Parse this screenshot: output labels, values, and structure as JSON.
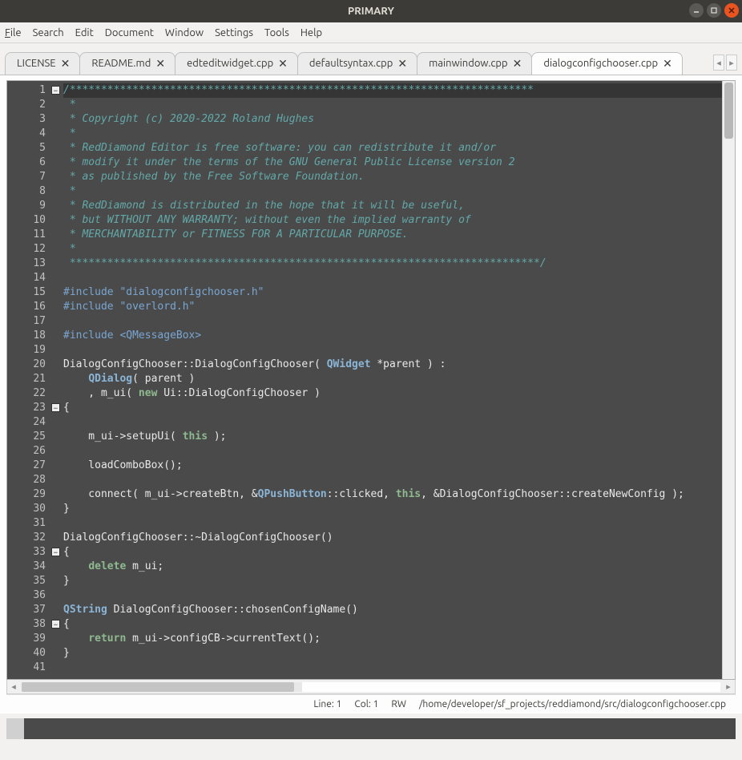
{
  "window": {
    "title": "PRIMARY"
  },
  "menu": {
    "file": "File",
    "search": "Search",
    "edit": "Edit",
    "document": "Document",
    "window": "Window",
    "settings": "Settings",
    "tools": "Tools",
    "help": "Help"
  },
  "tabs": [
    {
      "label": "LICENSE",
      "active": false
    },
    {
      "label": "README.md",
      "active": false
    },
    {
      "label": "edteditwidget.cpp",
      "active": false
    },
    {
      "label": "defaultsyntax.cpp",
      "active": false
    },
    {
      "label": "mainwindow.cpp",
      "active": false
    },
    {
      "label": "dialogconfigchooser.cpp",
      "active": true
    }
  ],
  "tabnav": {
    "left": "◂",
    "right": "▸"
  },
  "gutter_lines": 41,
  "fold_markers": [
    {
      "line": 1,
      "symbol": "−"
    },
    {
      "line": 23,
      "symbol": "−"
    },
    {
      "line": 33,
      "symbol": "−"
    },
    {
      "line": 38,
      "symbol": "−"
    }
  ],
  "code_lines": [
    {
      "n": 1,
      "segs": [
        {
          "cls": "cmt",
          "t": "/**************************************************************************"
        }
      ],
      "bg": true
    },
    {
      "n": 2,
      "segs": [
        {
          "cls": "cmt",
          "t": " *"
        }
      ]
    },
    {
      "n": 3,
      "segs": [
        {
          "cls": "cmt",
          "t": " * Copyright (c) 2020-2022 Roland Hughes"
        }
      ]
    },
    {
      "n": 4,
      "segs": [
        {
          "cls": "cmt",
          "t": " *"
        }
      ]
    },
    {
      "n": 5,
      "segs": [
        {
          "cls": "cmt",
          "t": " * RedDiamond Editor is free software: you can redistribute it and/or"
        }
      ]
    },
    {
      "n": 6,
      "segs": [
        {
          "cls": "cmt",
          "t": " * modify it under the terms of the GNU General Public License version 2"
        }
      ]
    },
    {
      "n": 7,
      "segs": [
        {
          "cls": "cmt",
          "t": " * as published by the Free Software Foundation."
        }
      ]
    },
    {
      "n": 8,
      "segs": [
        {
          "cls": "cmt",
          "t": " *"
        }
      ]
    },
    {
      "n": 9,
      "segs": [
        {
          "cls": "cmt",
          "t": " * RedDiamond is distributed in the hope that it will be useful,"
        }
      ]
    },
    {
      "n": 10,
      "segs": [
        {
          "cls": "cmt",
          "t": " * but WITHOUT ANY WARRANTY; without even the implied warranty of"
        }
      ]
    },
    {
      "n": 11,
      "segs": [
        {
          "cls": "cmt",
          "t": " * MERCHANTABILITY or FITNESS FOR A PARTICULAR PURPOSE."
        }
      ]
    },
    {
      "n": 12,
      "segs": [
        {
          "cls": "cmt",
          "t": " *"
        }
      ]
    },
    {
      "n": 13,
      "segs": [
        {
          "cls": "cmt",
          "t": " ***************************************************************************/"
        }
      ]
    },
    {
      "n": 14,
      "segs": [
        {
          "cls": "",
          "t": ""
        }
      ]
    },
    {
      "n": 15,
      "segs": [
        {
          "cls": "pp",
          "t": "#include "
        },
        {
          "cls": "str",
          "t": "\"dialogconfigchooser.h\""
        }
      ]
    },
    {
      "n": 16,
      "segs": [
        {
          "cls": "pp",
          "t": "#include "
        },
        {
          "cls": "str",
          "t": "\"overlord.h\""
        }
      ]
    },
    {
      "n": 17,
      "segs": [
        {
          "cls": "",
          "t": ""
        }
      ]
    },
    {
      "n": 18,
      "segs": [
        {
          "cls": "pp",
          "t": "#include "
        },
        {
          "cls": "str",
          "t": "<QMessageBox>"
        }
      ]
    },
    {
      "n": 19,
      "segs": [
        {
          "cls": "",
          "t": ""
        }
      ]
    },
    {
      "n": 20,
      "segs": [
        {
          "cls": "",
          "t": "DialogConfigChooser::DialogConfigChooser( "
        },
        {
          "cls": "type",
          "t": "QWidget"
        },
        {
          "cls": "",
          "t": " *parent ) :"
        }
      ]
    },
    {
      "n": 21,
      "segs": [
        {
          "cls": "",
          "t": "    "
        },
        {
          "cls": "type",
          "t": "QDialog"
        },
        {
          "cls": "",
          "t": "( parent )"
        }
      ]
    },
    {
      "n": 22,
      "segs": [
        {
          "cls": "",
          "t": "    , m_ui( "
        },
        {
          "cls": "kw",
          "t": "new"
        },
        {
          "cls": "",
          "t": " Ui::DialogConfigChooser )"
        }
      ]
    },
    {
      "n": 23,
      "segs": [
        {
          "cls": "",
          "t": "{"
        }
      ]
    },
    {
      "n": 24,
      "segs": [
        {
          "cls": "",
          "t": ""
        }
      ]
    },
    {
      "n": 25,
      "segs": [
        {
          "cls": "",
          "t": "    m_ui->setupUi( "
        },
        {
          "cls": "kw",
          "t": "this"
        },
        {
          "cls": "",
          "t": " );"
        }
      ]
    },
    {
      "n": 26,
      "segs": [
        {
          "cls": "",
          "t": ""
        }
      ]
    },
    {
      "n": 27,
      "segs": [
        {
          "cls": "",
          "t": "    loadComboBox();"
        }
      ]
    },
    {
      "n": 28,
      "segs": [
        {
          "cls": "",
          "t": ""
        }
      ]
    },
    {
      "n": 29,
      "segs": [
        {
          "cls": "",
          "t": "    connect( m_ui->createBtn, &"
        },
        {
          "cls": "type",
          "t": "QPushButton"
        },
        {
          "cls": "",
          "t": "::clicked, "
        },
        {
          "cls": "kw",
          "t": "this"
        },
        {
          "cls": "",
          "t": ", &DialogConfigChooser::createNewConfig );"
        }
      ]
    },
    {
      "n": 30,
      "segs": [
        {
          "cls": "",
          "t": "}"
        }
      ]
    },
    {
      "n": 31,
      "segs": [
        {
          "cls": "",
          "t": ""
        }
      ]
    },
    {
      "n": 32,
      "segs": [
        {
          "cls": "",
          "t": "DialogConfigChooser::~DialogConfigChooser()"
        }
      ]
    },
    {
      "n": 33,
      "segs": [
        {
          "cls": "",
          "t": "{"
        }
      ]
    },
    {
      "n": 34,
      "segs": [
        {
          "cls": "",
          "t": "    "
        },
        {
          "cls": "kw",
          "t": "delete"
        },
        {
          "cls": "",
          "t": " m_ui;"
        }
      ]
    },
    {
      "n": 35,
      "segs": [
        {
          "cls": "",
          "t": "}"
        }
      ]
    },
    {
      "n": 36,
      "segs": [
        {
          "cls": "",
          "t": ""
        }
      ]
    },
    {
      "n": 37,
      "segs": [
        {
          "cls": "type",
          "t": "QString"
        },
        {
          "cls": "",
          "t": " DialogConfigChooser::chosenConfigName()"
        }
      ]
    },
    {
      "n": 38,
      "segs": [
        {
          "cls": "",
          "t": "{"
        }
      ]
    },
    {
      "n": 39,
      "segs": [
        {
          "cls": "",
          "t": "    "
        },
        {
          "cls": "kw",
          "t": "return"
        },
        {
          "cls": "",
          "t": " m_ui->configCB->currentText();"
        }
      ]
    },
    {
      "n": 40,
      "segs": [
        {
          "cls": "",
          "t": "}"
        }
      ]
    },
    {
      "n": 41,
      "segs": [
        {
          "cls": "",
          "t": ""
        }
      ]
    }
  ],
  "status": {
    "line": "Line: 1",
    "col": "Col: 1",
    "mode": "RW",
    "path": "/home/developer/sf_projects/reddiamond/src/dialogconfigchooser.cpp"
  }
}
